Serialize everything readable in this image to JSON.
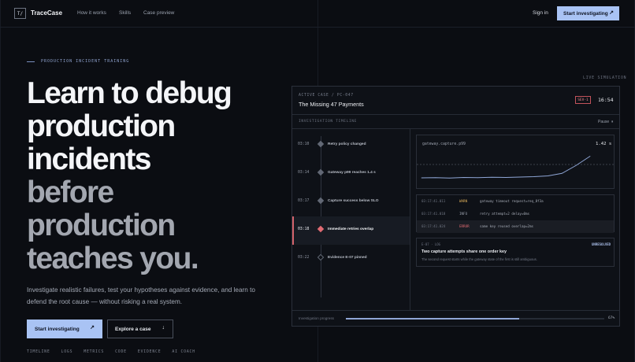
{
  "nav": {
    "logo_glyph": "T/",
    "brand": "TraceCase",
    "links": [
      "How it works",
      "Skills",
      "Case preview"
    ],
    "signin": "Sign in",
    "cta": "Start investigating",
    "cta_icon": "arrow-up-right-icon"
  },
  "hero": {
    "eyebrow": "PRODUCTION INCIDENT TRAINING",
    "headline_lines": [
      "Learn to debug",
      "production",
      "incidents",
      "before",
      "production",
      "teaches you."
    ],
    "subtitle": "Investigate realistic failures, test your hypotheses against evidence, and learn to defend the root cause — without risking a real system.",
    "primary_button": "Start investigating",
    "secondary_button": "Explore a case",
    "tags": [
      "TIMELINE",
      "LOGS",
      "METRICS",
      "CODE",
      "EVIDENCE",
      "AI COACH"
    ]
  },
  "sim": {
    "live_label": "LIVE SIMULATION",
    "case_id": "ACTIVE CASE / PC-047",
    "case_title": "The Missing 47 Payments",
    "severity": "SEV-1",
    "clock": "16:54",
    "timeline_heading": "INVESTIGATION TIMELINE",
    "pause_label": "Pause",
    "timeline": [
      {
        "time": "03:10",
        "label": "Retry policy changed",
        "state": "done"
      },
      {
        "time": "03:14",
        "label": "Gateway p99 reaches 1.4 s",
        "state": "done"
      },
      {
        "time": "03:17",
        "label": "Capture success below SLO",
        "state": "done"
      },
      {
        "time": "03:18",
        "label": "Immediate retries overlap",
        "state": "active"
      },
      {
        "time": "03:22",
        "label": "Evidence E-07 pinned",
        "state": "pending"
      }
    ],
    "metric": {
      "name": "gateway.capture.p99",
      "value": "1.42 s"
    },
    "logs": [
      {
        "time": "03:17:41.011",
        "level": "WARN",
        "msg": "gateway timeout request=req_8f3a"
      },
      {
        "time": "03:17:41.018",
        "level": "INFO",
        "msg": "retry attempt=2 delay=0ms"
      },
      {
        "time": "03:17:41.024",
        "level": "ERROR",
        "msg": "same key reused overlap=2ms"
      }
    ],
    "finding": {
      "meta": "E-07 · LOG",
      "status": "UNRESOLVED",
      "title": "Two capture attempts share one order key",
      "desc": "The second request starts while the gateway state of the first is still ambiguous."
    },
    "progress": {
      "label": "Investigation progress",
      "value": 0.67,
      "text": "67%"
    }
  },
  "colors": {
    "accent": "#a9c3f4",
    "danger": "#e16b73",
    "warn": "#e0b25c",
    "line": "#8fa6d6"
  },
  "chart_data": {
    "type": "line",
    "title": "gateway.capture.p99",
    "x": [
      0,
      1,
      2,
      3,
      4,
      5,
      6,
      7,
      8,
      9,
      10,
      11,
      12
    ],
    "values": [
      0.32,
      0.33,
      0.31,
      0.34,
      0.33,
      0.35,
      0.34,
      0.36,
      0.38,
      0.42,
      0.55,
      0.95,
      1.42
    ],
    "threshold": 1.0,
    "ylim": [
      0,
      1.6
    ],
    "grid": false
  }
}
